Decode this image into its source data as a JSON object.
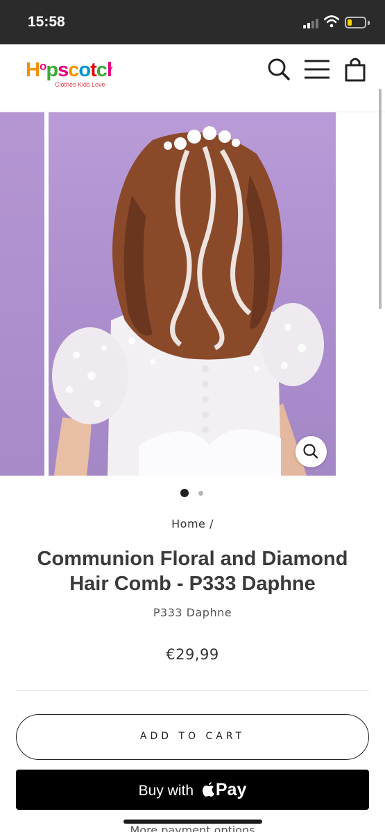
{
  "status_bar": {
    "time": "15:58"
  },
  "header": {
    "logo": {
      "word": "Hopscotch",
      "tagline": "Clothes Kids Love"
    },
    "icons": [
      "search-icon",
      "menu-icon",
      "cart-icon"
    ]
  },
  "gallery": {
    "image_count": 2,
    "active_index": 0,
    "zoom_icon": "zoom-icon"
  },
  "product": {
    "breadcrumb": "Home /",
    "title": "Communion Floral and Diamond Hair Comb - P333 Daphne",
    "sku": "P333 Daphne",
    "price": "€29,99"
  },
  "actions": {
    "add_to_cart": "ADD TO CART",
    "buy_with": "Buy with",
    "pay": "Pay",
    "more_payment": "More payment options"
  },
  "colors": {
    "status_bar": "#2b2b2b",
    "image_background": "#ad8fce",
    "apple_pay_button": "#000000"
  }
}
